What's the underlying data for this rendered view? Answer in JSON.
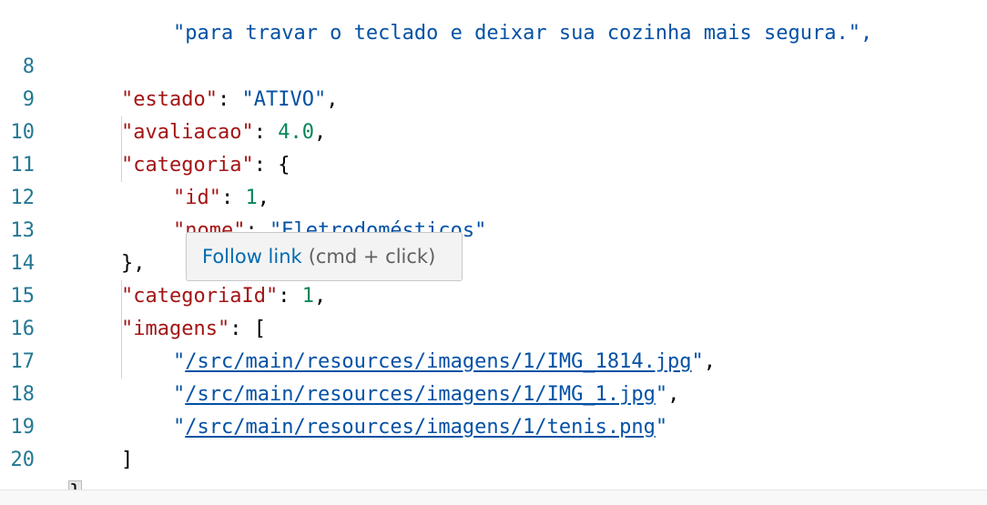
{
  "editor": {
    "partial_line": "\"para travar o teclado e deixar sua cozinha mais segura.\",",
    "lines": [
      {
        "num": "8"
      },
      {
        "num": "9"
      },
      {
        "num": "10"
      },
      {
        "num": "11"
      },
      {
        "num": "12"
      },
      {
        "num": "13"
      },
      {
        "num": "14"
      },
      {
        "num": "15"
      },
      {
        "num": "16"
      },
      {
        "num": "17"
      },
      {
        "num": "18"
      },
      {
        "num": "19"
      },
      {
        "num": "20"
      }
    ],
    "tokens": {
      "estado_key": "\"estado\"",
      "estado_val": "\"ATIVO\"",
      "avaliacao_key": "\"avaliacao\"",
      "avaliacao_val": "4.0",
      "categoria_key": "\"categoria\"",
      "open_brace": "{",
      "id_key": "\"id\"",
      "id_val": "1",
      "nome_key": "\"nome\"",
      "nome_val": "\"Eletrodomésticos\"",
      "close_brace_comma": "},",
      "categoriaId_key": "\"categoriaId\"",
      "categoriaId_val": "1",
      "imagens_key": "\"imagens\"",
      "open_bracket": "[",
      "img1_path": "/src/main/resources/imagens/1/IMG_1814.jpg",
      "img2_path": "/src/main/resources/imagens/1/IMG_1.jpg",
      "img3_path": "/src/main/resources/imagens/1/tenis.png",
      "close_bracket": "]",
      "final_brace": "}"
    }
  },
  "tooltip": {
    "action": "Follow link",
    "hint": "(cmd + click)"
  },
  "colors": {
    "key": "#a31515",
    "string": "#0451a5",
    "number": "#098658",
    "line_number": "#237893",
    "link": "#006ab1"
  }
}
